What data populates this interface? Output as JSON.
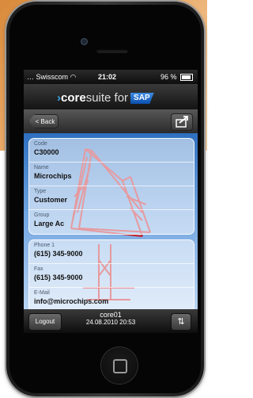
{
  "status_bar": {
    "carrier": "Swisscom",
    "time": "21:02",
    "battery": "96 %"
  },
  "brand": {
    "prefix": "core",
    "suffix": "suite for",
    "logo_text": "SAP"
  },
  "nav": {
    "back_label": "< Back",
    "share_icon": "share-icon"
  },
  "fields_group1": [
    {
      "label": "Code",
      "value": "C30000"
    },
    {
      "label": "Name",
      "value": "Microchips"
    },
    {
      "label": "Type",
      "value": "Customer"
    },
    {
      "label": "Group",
      "value": "Large Ac"
    }
  ],
  "fields_group2": [
    {
      "label": "Phone 1",
      "value": "(615) 345-9000"
    },
    {
      "label": "Fax",
      "value": "(615) 345-9000"
    },
    {
      "label": "E-Mail",
      "value": "info@microchips.com"
    }
  ],
  "toolbar": {
    "logout_label": "Logout",
    "user": "core01",
    "timestamp": "24.08.2010 20:53",
    "sync_icon": "sync-icon"
  },
  "colors": {
    "brand_accent": "#3ba0e6",
    "sap_blue": "#0b4fae",
    "orange_backdrop": "#e9a866"
  }
}
